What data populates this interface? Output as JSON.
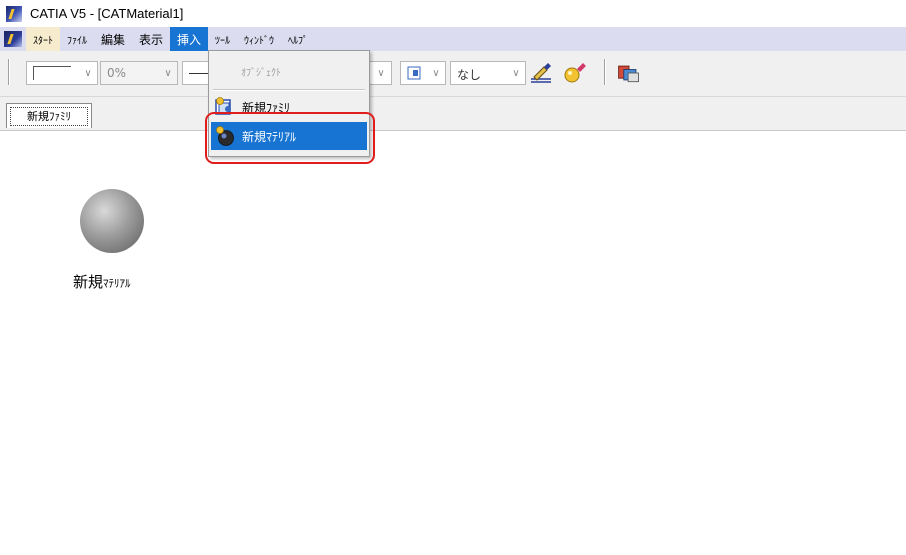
{
  "window": {
    "title": "CATIA V5 - [CATMaterial1]"
  },
  "menubar": {
    "items": [
      {
        "label": "ｽﾀｰﾄ"
      },
      {
        "label": "ﾌｧｲﾙ"
      },
      {
        "label": "編集"
      },
      {
        "label": "表示"
      },
      {
        "label": "挿入"
      },
      {
        "label": "ﾂｰﾙ"
      },
      {
        "label": "ｳｨﾝﾄﾞｳ"
      },
      {
        "label": "ﾍﾙﾌﾟ"
      }
    ],
    "active_index": 4
  },
  "toolbar": {
    "transparency_value": "0%",
    "linetype_value": "なし"
  },
  "insert_menu": {
    "items": [
      {
        "label": "ｵﾌﾞｼﾞｪｸﾄ",
        "enabled": false
      },
      {
        "label": "新規ﾌｧﾐﾘ",
        "enabled": true
      },
      {
        "label": "新規ﾏﾃﾘｱﾙ",
        "enabled": true,
        "highlighted": true
      }
    ]
  },
  "tabs": [
    {
      "label": "新規ﾌｧﾐﾘ"
    }
  ],
  "canvas": {
    "material": {
      "label_main": "新規",
      "label_small": "ﾏﾃﾘｱﾙ"
    }
  },
  "colors": {
    "menu_highlight": "#1874d2",
    "callout_ring": "#e01d1d",
    "menubar_bg": "#dcdcf0"
  },
  "icons": [
    "catia-logo-icon",
    "paintbrush-icon",
    "material-apply-icon",
    "material-library-icon",
    "family-icon",
    "material-icon"
  ]
}
